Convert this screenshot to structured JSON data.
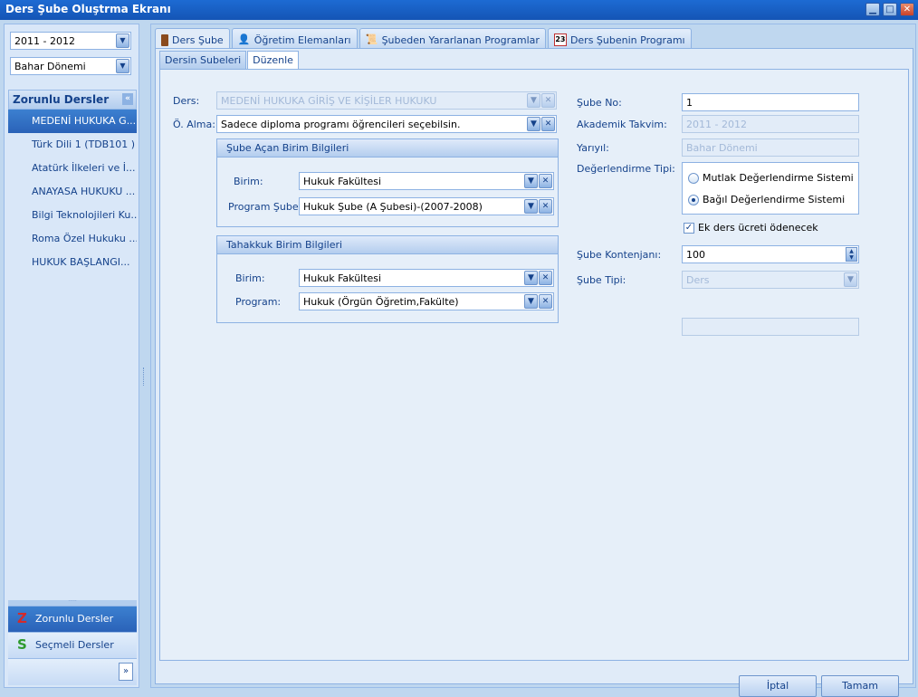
{
  "window": {
    "title": "Ders Şube Oluştrma Ekranı"
  },
  "sidebar": {
    "year": "2011 - 2012",
    "term": "Bahar Dönemi",
    "section_title": "Zorunlu Dersler",
    "items": [
      "MEDENİ HUKUKA G...",
      "Türk Dili 1 (TDB101  )",
      "Atatürk İlkeleri ve İ...",
      "ANAYASA HUKUKU ...",
      "Bilgi Teknolojileri Ku...",
      "Roma Özel Hukuku ...",
      "HUKUK  BAŞLANGI..."
    ],
    "bottom_items": [
      {
        "letter": "Z",
        "label": "Zorunlu Dersler",
        "color": "#d42a2a"
      },
      {
        "letter": "S",
        "label": "Seçmeli Dersler",
        "color": "#2e9a2e"
      }
    ]
  },
  "tabs": [
    {
      "label": "Ders Şube",
      "icon": "door-icon"
    },
    {
      "label": "Öğretim Elemanları",
      "icon": "person-icon"
    },
    {
      "label": "Şubeden Yararlanan  Programlar",
      "icon": "scroll-icon"
    },
    {
      "label": "Ders Şubenin Programı",
      "icon": "calendar-icon",
      "icon_text": "23"
    }
  ],
  "subtabs": [
    "Dersin Subeleri",
    "Düzenle"
  ],
  "form": {
    "ders_label": "Ders:",
    "ders_value": "MEDENİ HUKUKA GİRİŞ VE KİŞİLER HUKUKU",
    "oalma_label": "Ö. Alma:",
    "oalma_value": "Sadece diploma programı öğrencileri seçebilsin.",
    "group1_title": "Şube Açan Birim Bilgileri",
    "birim_label": "Birim:",
    "birim_value": "Hukuk Fakültesi",
    "program_sube_label": "Program Şube:",
    "program_sube_value": "Hukuk  Şube (A Şubesi)-(2007-2008)",
    "group2_title": "Tahakkuk Birim Bilgileri",
    "birim2_label": "Birim:",
    "birim2_value": "Hukuk Fakültesi",
    "program_label": "Program:",
    "program_value": "Hukuk  (Örgün Öğretim,Fakülte)",
    "sube_no_label": "Şube No:",
    "sube_no_value": "1",
    "akademik_label": "Akademik Takvim:",
    "akademik_value": "2011 - 2012",
    "yariyil_label": "Yarıyıl:",
    "yariyil_value": "Bahar Dönemi",
    "degerlendirme_label": "Değerlendirme Tipi:",
    "radio1": "Mutlak Değerlendirme Sistemi",
    "radio2": "Bağıl Değerlendirme Sistemi",
    "ek_ders_label": "Ek ders ücreti ödenecek",
    "kontenjan_label": "Şube Kontenjanı:",
    "kontenjan_value": "100",
    "sube_tipi_label": "Şube Tipi:",
    "sube_tipi_value": "Ders"
  },
  "buttons": {
    "cancel": "İptal",
    "ok": "Tamam"
  }
}
